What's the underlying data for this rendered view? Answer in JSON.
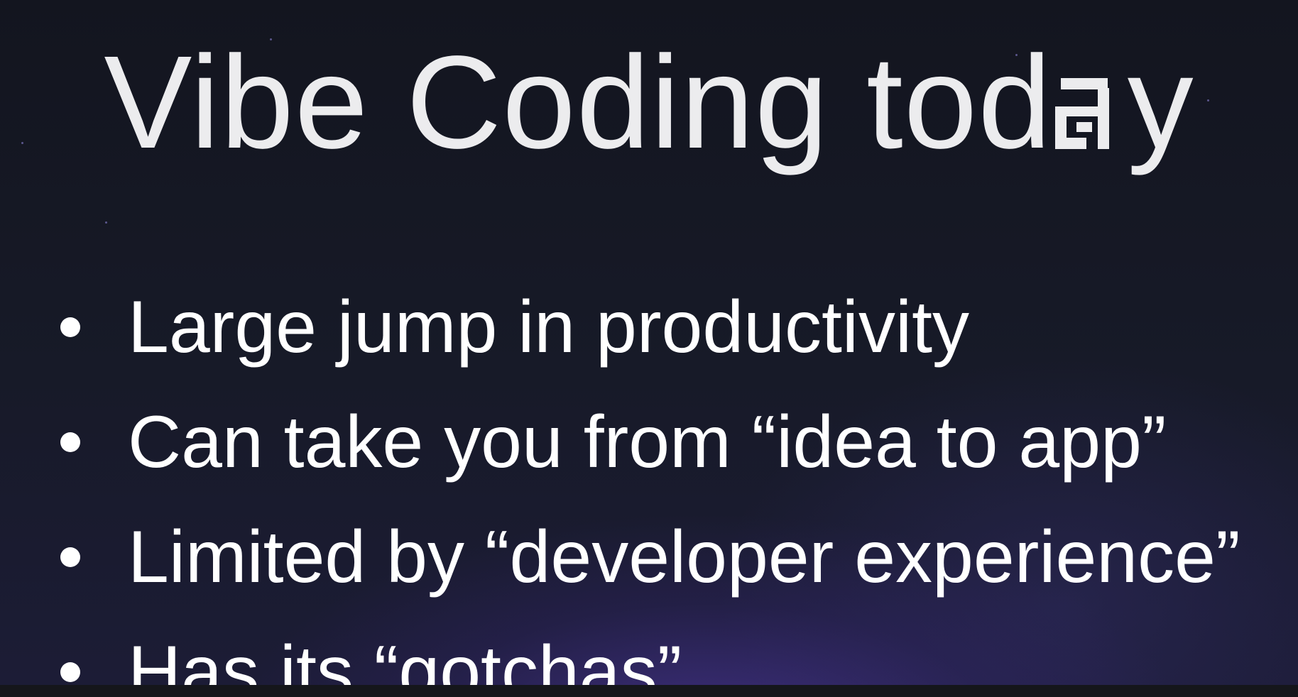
{
  "slide": {
    "title_prefix": "Vibe Coding tod",
    "title_suffix": "y",
    "title_glitch_letter": "a",
    "bullets": [
      "Large jump in productivity",
      "Can take you from “idea to app”",
      "Limited by “developer experience”",
      "Has its “gotchas”"
    ]
  },
  "colors": {
    "background": "#141620",
    "accent_glow": "#5c40be",
    "text": "#ffffff"
  }
}
